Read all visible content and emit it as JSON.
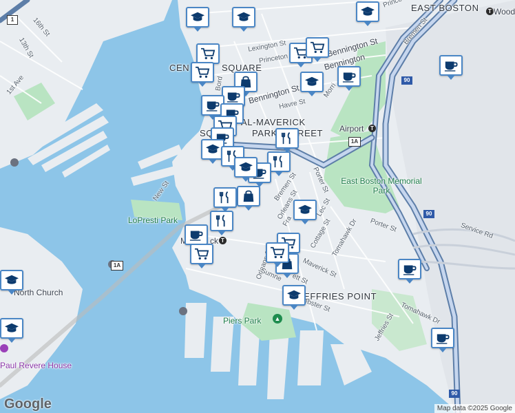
{
  "map": {
    "areas": [
      {
        "id": "east-boston",
        "text": "EAST BOSTON"
      },
      {
        "id": "central-square-a",
        "text": "CEN"
      },
      {
        "id": "central-square-b",
        "text": "SQUARE"
      },
      {
        "id": "central-maverick-a",
        "text": "AL-MAVERICK"
      },
      {
        "id": "central-maverick-b",
        "text": "SQ"
      },
      {
        "id": "central-maverick-c",
        "text": "PARK"
      },
      {
        "id": "central-maverick-d",
        "text": "REET"
      },
      {
        "id": "jeffries-point",
        "text": "JEFFRIES POINT"
      }
    ],
    "parks": [
      {
        "id": "east-boston-memorial-park",
        "text": "East Boston Memorial Park"
      },
      {
        "id": "lopresti-park",
        "text": "LoPresti Park"
      },
      {
        "id": "piers-park",
        "text": "Piers Park"
      }
    ],
    "pois": [
      {
        "id": "airport-station",
        "text": "Airport"
      },
      {
        "id": "maverick-station-a",
        "text": "M"
      },
      {
        "id": "maverick-station-b",
        "text": "ck"
      },
      {
        "id": "north-church",
        "text": "North Church"
      },
      {
        "id": "paul-revere-house",
        "text": "Paul Revere House"
      },
      {
        "id": "wood",
        "text": "Wood"
      }
    ],
    "streets": [
      {
        "id": "prince",
        "text": "Prince"
      },
      {
        "id": "16th-st",
        "text": "16th St"
      },
      {
        "id": "13th-st",
        "text": "13th St"
      },
      {
        "id": "1st-ave",
        "text": "1st Ave"
      },
      {
        "id": "lexington-st",
        "text": "Lexington St"
      },
      {
        "id": "princeton",
        "text": "Princeton"
      },
      {
        "id": "bennington-st-upper",
        "text": "Bennington St"
      },
      {
        "id": "bennington-st-mid",
        "text": "Bennington"
      },
      {
        "id": "bennington-st-left",
        "text": "Bennington St"
      },
      {
        "id": "bremen-st-upper",
        "text": "Bremen St"
      },
      {
        "id": "havre-st",
        "text": "Havre St"
      },
      {
        "id": "morris",
        "text": "Morri"
      },
      {
        "id": "bord",
        "text": "Bord"
      },
      {
        "id": "new-st",
        "text": "New St"
      },
      {
        "id": "bremen-st-lower",
        "text": "Bremen St"
      },
      {
        "id": "porter-st-upper",
        "text": "Porter St"
      },
      {
        "id": "orleans-st-upper",
        "text": "Orleans St"
      },
      {
        "id": "orleans-st-lower",
        "text": "Orleans St"
      },
      {
        "id": "frankfort",
        "text": "Fra"
      },
      {
        "id": "cottage-st",
        "text": "Cottage St"
      },
      {
        "id": "tomahawk-dr-upper",
        "text": "Tomahawk Dr"
      },
      {
        "id": "porter-st-lower",
        "text": "Porter St"
      },
      {
        "id": "service-rd",
        "text": "Service Rd"
      },
      {
        "id": "maverick-st",
        "text": "Maverick St"
      },
      {
        "id": "sumner-st",
        "text": "Sumne"
      },
      {
        "id": "everett-st",
        "text": "ett St"
      },
      {
        "id": "webster-st",
        "text": "ebster St"
      },
      {
        "id": "jeffries-st",
        "text": "Jeffries St"
      },
      {
        "id": "tomahawk-dr-lower",
        "text": "Tomahawk Dr"
      },
      {
        "id": "lec-st",
        "text": "Lec St"
      }
    ],
    "shields": [
      {
        "id": "rt1",
        "text": "1"
      },
      {
        "id": "i90-a",
        "text": "90"
      },
      {
        "id": "i90-b",
        "text": "90"
      },
      {
        "id": "i90-c",
        "text": "90"
      },
      {
        "id": "rt1a-a",
        "text": "1A"
      },
      {
        "id": "rt1a-b",
        "text": "1A"
      }
    ],
    "pins": [
      {
        "icon": "school"
      },
      {
        "icon": "school"
      },
      {
        "icon": "school"
      },
      {
        "icon": "cart"
      },
      {
        "icon": "cart"
      },
      {
        "icon": "cart"
      },
      {
        "icon": "cart"
      },
      {
        "icon": "coffee"
      },
      {
        "icon": "coffee"
      },
      {
        "icon": "bag"
      },
      {
        "icon": "coffee"
      },
      {
        "icon": "school"
      },
      {
        "icon": "coffee"
      },
      {
        "icon": "coffee"
      },
      {
        "icon": "cart"
      },
      {
        "icon": "coffee"
      },
      {
        "icon": "school"
      },
      {
        "icon": "food"
      },
      {
        "icon": "food"
      },
      {
        "icon": "food"
      },
      {
        "icon": "coffee"
      },
      {
        "icon": "school"
      },
      {
        "icon": "bag"
      },
      {
        "icon": "food"
      },
      {
        "icon": "food"
      },
      {
        "icon": "coffee"
      },
      {
        "icon": "cart"
      },
      {
        "icon": "school"
      },
      {
        "icon": "cart"
      },
      {
        "icon": "bag"
      },
      {
        "icon": "school"
      },
      {
        "icon": "coffee"
      },
      {
        "icon": "coffee"
      },
      {
        "icon": "school"
      },
      {
        "icon": "school"
      },
      {
        "icon": "cart"
      }
    ],
    "attribution": "Map data ©2025 Google",
    "logo": "Google"
  }
}
